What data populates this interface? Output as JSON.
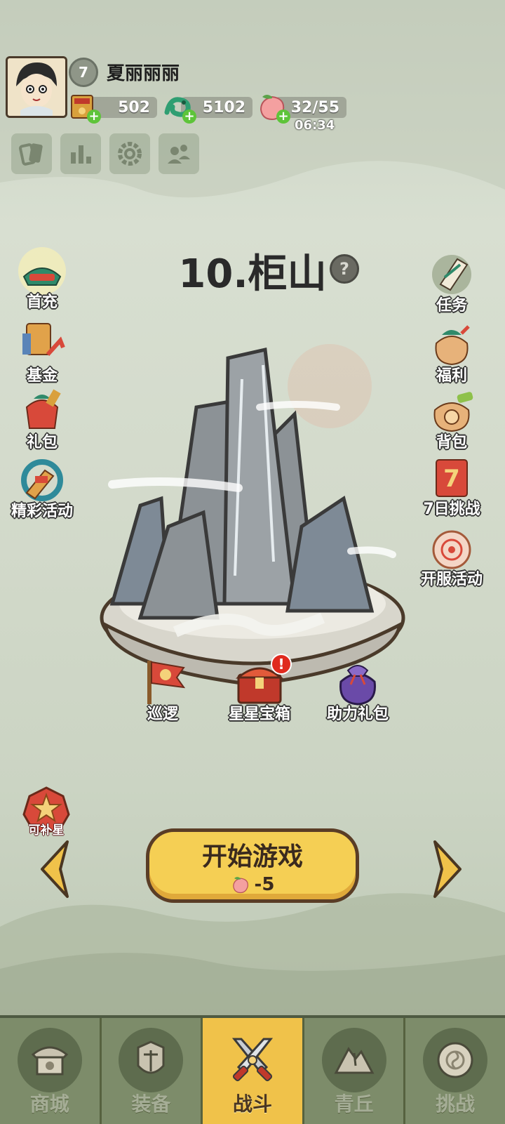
{
  "player": {
    "level": "7",
    "name": "夏丽丽丽",
    "avatar_icon": "player-avatar"
  },
  "resources": [
    {
      "name": "tickets",
      "icon": "ticket-icon",
      "value": "502"
    },
    {
      "name": "jade",
      "icon": "jade-dragon-icon",
      "value": "5102"
    },
    {
      "name": "stamina",
      "icon": "peach-icon",
      "value": "32/55"
    }
  ],
  "stamina_timer": "06:34",
  "toolbar_icons": [
    "cards-icon",
    "ranking-icon",
    "settings-icon",
    "friends-icon"
  ],
  "stage": {
    "title": "10.柜山",
    "help_icon": "question-icon"
  },
  "left_menu": [
    {
      "label": "首充",
      "icon": "first-recharge-icon"
    },
    {
      "label": "基金",
      "icon": "fund-icon"
    },
    {
      "label": "礼包",
      "icon": "gift-pack-icon"
    },
    {
      "label": "精彩活动",
      "icon": "events-icon"
    }
  ],
  "right_menu": [
    {
      "label": "任务",
      "icon": "scroll-task-icon"
    },
    {
      "label": "福利",
      "icon": "welfare-bag-icon"
    },
    {
      "label": "背包",
      "icon": "backpack-icon"
    },
    {
      "label": "7日挑战",
      "icon": "seven-day-challenge-icon"
    },
    {
      "label": "开服活动",
      "icon": "server-launch-icon"
    }
  ],
  "stage_actions": [
    {
      "label": "巡逻",
      "icon": "patrol-flag-icon"
    },
    {
      "label": "星星宝箱",
      "icon": "star-chest-icon",
      "badge": "!"
    },
    {
      "label": "助力礼包",
      "icon": "support-gift-bag-icon"
    }
  ],
  "star_badge": {
    "label": "可补星",
    "icon": "star-icon"
  },
  "start_button": {
    "label": "开始游戏",
    "cost": "-5",
    "cost_icon": "peach-icon"
  },
  "nav": [
    {
      "label": "商城",
      "icon": "shop-icon",
      "active": false
    },
    {
      "label": "装备",
      "icon": "armor-icon",
      "active": false
    },
    {
      "label": "战斗",
      "icon": "crossed-swords-icon",
      "active": true
    },
    {
      "label": "青丘",
      "icon": "mountain-icon",
      "active": false
    },
    {
      "label": "挑战",
      "icon": "challenge-drum-icon",
      "active": false
    }
  ],
  "colors": {
    "accent": "#f0c24a",
    "nav_bg": "#7d8c6a",
    "badge_red": "#e02a1e",
    "plus_green": "#5ec43a"
  }
}
